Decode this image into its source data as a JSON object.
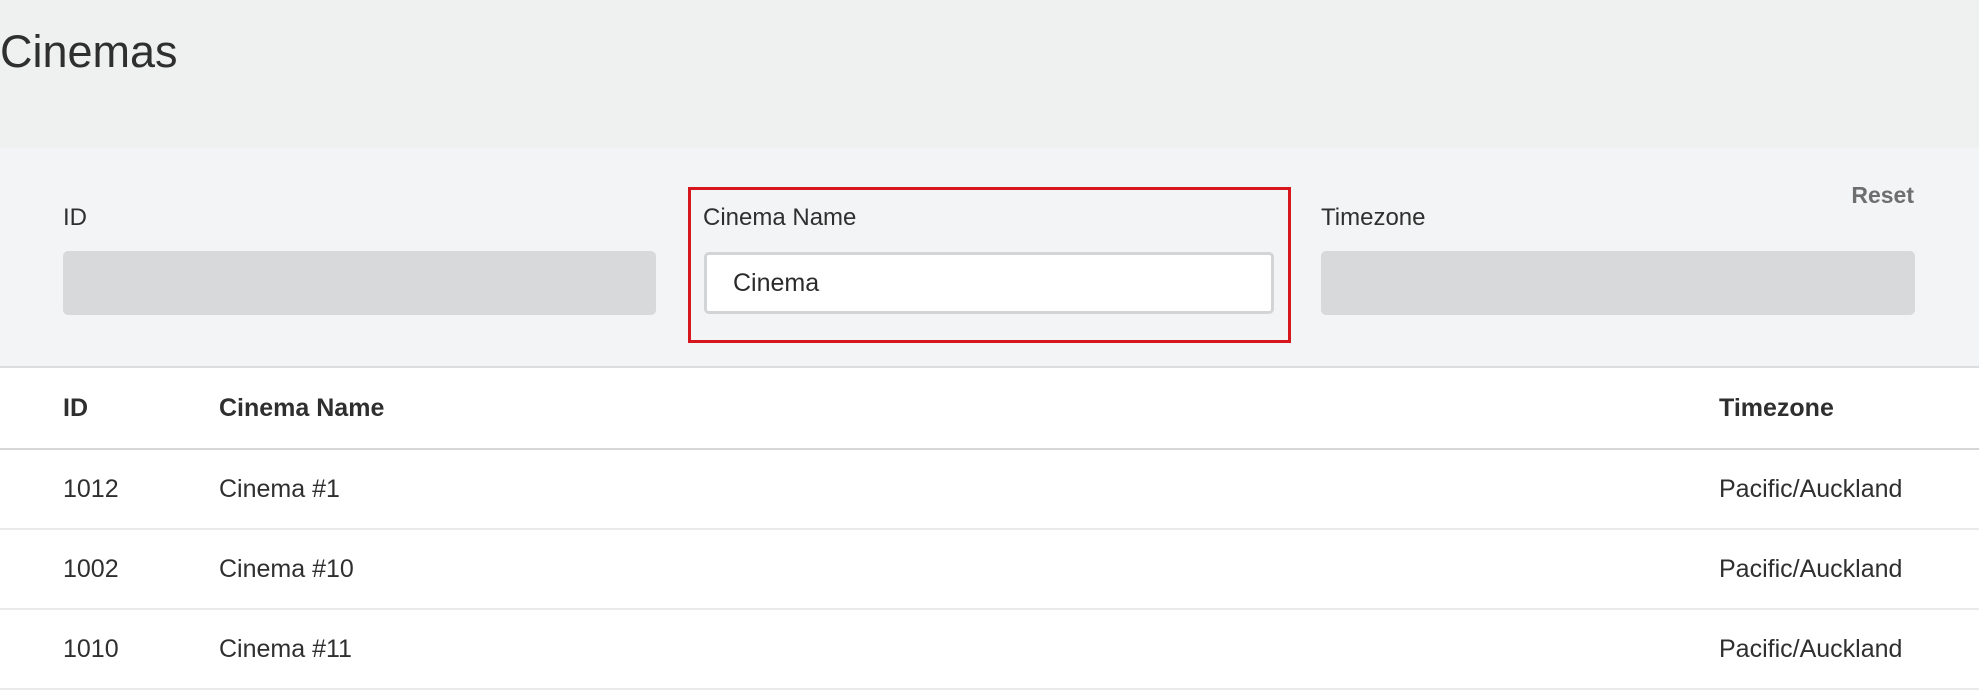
{
  "page": {
    "title": "Cinemas"
  },
  "filters": {
    "reset_label": "Reset",
    "id": {
      "label": "ID",
      "value": ""
    },
    "cinema_name": {
      "label": "Cinema Name",
      "value": "Cinema"
    },
    "timezone": {
      "label": "Timezone",
      "value": ""
    },
    "highlight_color": "#d5161d"
  },
  "table": {
    "headers": {
      "id": "ID",
      "cinema_name": "Cinema Name",
      "timezone": "Timezone"
    },
    "rows": [
      {
        "id": "1012",
        "cinema_name": "Cinema #1",
        "timezone": "Pacific/Auckland"
      },
      {
        "id": "1002",
        "cinema_name": "Cinema #10",
        "timezone": "Pacific/Auckland"
      },
      {
        "id": "1010",
        "cinema_name": "Cinema #11",
        "timezone": "Pacific/Auckland"
      }
    ]
  }
}
